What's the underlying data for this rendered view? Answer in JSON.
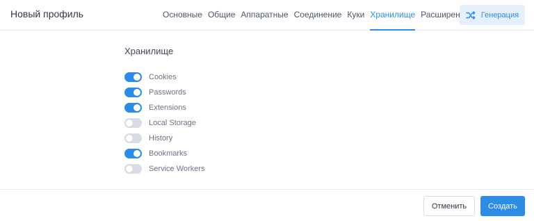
{
  "header": {
    "title": "Новый профиль",
    "tabs": [
      {
        "label": "Основные",
        "active": false
      },
      {
        "label": "Общие",
        "active": false
      },
      {
        "label": "Аппаратные",
        "active": false
      },
      {
        "label": "Соединение",
        "active": false
      },
      {
        "label": "Куки",
        "active": false
      },
      {
        "label": "Хранилище",
        "active": true
      },
      {
        "label": "Расширения",
        "active": false
      }
    ],
    "generate_button": {
      "label": "Генерация",
      "icon": "shuffle-icon"
    }
  },
  "storage": {
    "section_title": "Хранилище",
    "toggles": [
      {
        "label": "Cookies",
        "on": true
      },
      {
        "label": "Passwords",
        "on": true
      },
      {
        "label": "Extensions",
        "on": true
      },
      {
        "label": "Local Storage",
        "on": false
      },
      {
        "label": "History",
        "on": false
      },
      {
        "label": "Bookmarks",
        "on": true
      },
      {
        "label": "Service Workers",
        "on": false
      }
    ]
  },
  "footer": {
    "cancel_label": "Отменить",
    "create_label": "Создать"
  },
  "colors": {
    "accent": "#2d8ce6",
    "toggle_off": "#d9dde3"
  }
}
